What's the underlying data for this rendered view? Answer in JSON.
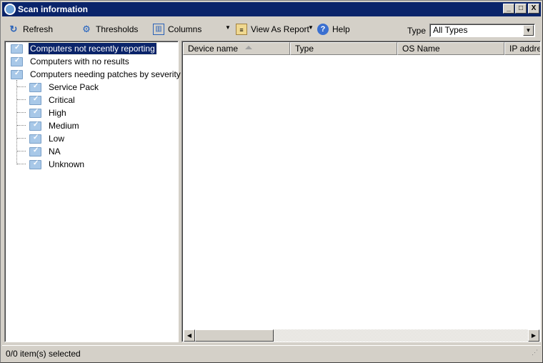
{
  "window": {
    "title": "Scan information",
    "controls": [
      "_",
      "□",
      "X"
    ]
  },
  "toolbar": {
    "refresh": "Refresh",
    "thresholds": "Thresholds",
    "columns": "Columns",
    "view_as_report": "View As Report",
    "help": "Help",
    "type_label": "Type",
    "type_value": "All Types"
  },
  "tree": {
    "roots": [
      "Computers not recently reporting",
      "Computers with no results",
      "Computers needing patches by severity"
    ],
    "children": [
      "Service Pack",
      "Critical",
      "High",
      "Medium",
      "Low",
      "NA",
      "Unknown"
    ],
    "selected": "Computers not recently reporting"
  },
  "table": {
    "columns": [
      "Device name",
      "Type",
      "OS Name",
      "IP address"
    ],
    "sorted_column": "Device name",
    "rows": []
  },
  "status": {
    "text": "0/0 item(s) selected"
  },
  "colors": {
    "titlebar": "#0a246a",
    "chrome": "#d4d0c8"
  }
}
